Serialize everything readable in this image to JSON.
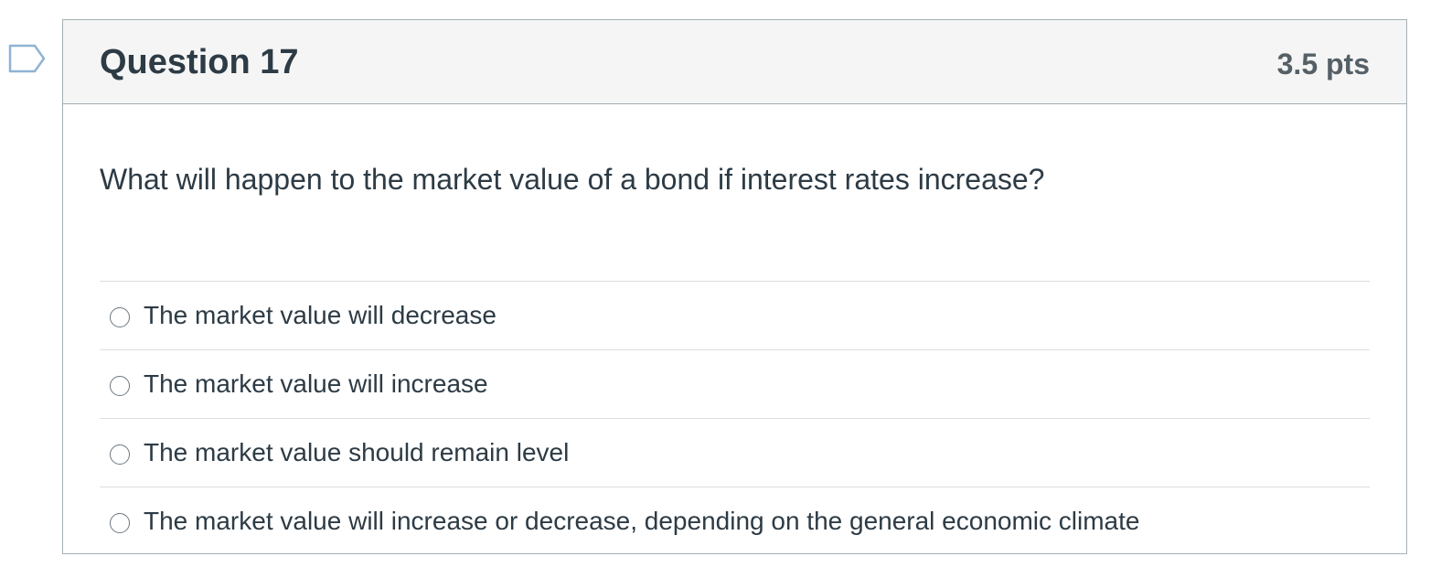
{
  "question": {
    "title": "Question 17",
    "points": "3.5 pts",
    "text": "What will happen to the market value of a bond if interest rates increase?",
    "answers": [
      {
        "label": "The market value will decrease",
        "selected": false
      },
      {
        "label": "The market value will increase",
        "selected": false
      },
      {
        "label": "The market value should remain level",
        "selected": false
      },
      {
        "label": "The market value will increase or decrease, depending on the general economic climate",
        "selected": false
      }
    ]
  },
  "colors": {
    "flag_outline": "#8fb3d3",
    "header_background": "#f5f5f5",
    "border": "#a5afb5",
    "text": "#2d3b45",
    "points_text": "#555f66",
    "divider": "#dcdedf"
  },
  "icons": {
    "flag": "flag-question-icon",
    "radio": "radio-unchecked-icon"
  }
}
